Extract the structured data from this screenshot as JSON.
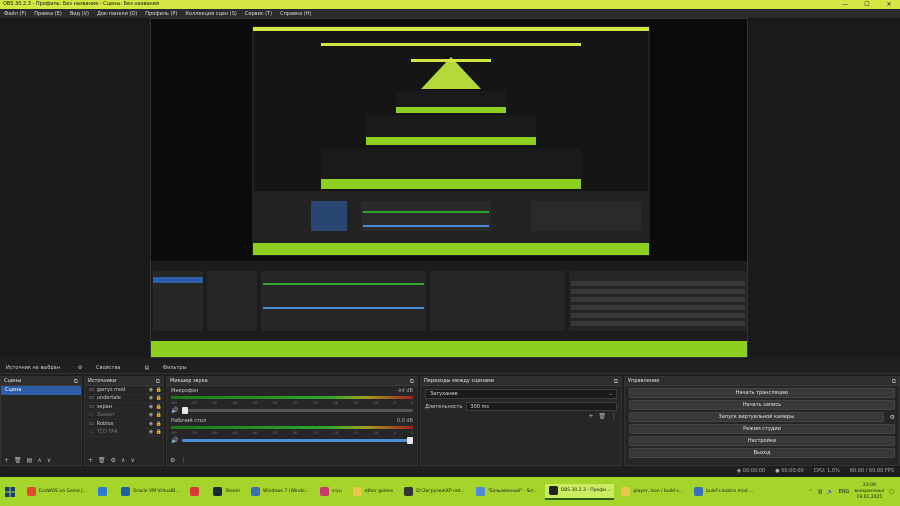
{
  "app": {
    "window_title": "OBS 30.2.3 - Профиль: Без названия - Сцены: Без названия"
  },
  "menu": [
    "Файл (F)",
    "Правка (E)",
    "Вид (V)",
    "Док-панели (D)",
    "Профиль (P)",
    "Коллекция сцен (S)",
    "Сервис (T)",
    "Справка (H)"
  ],
  "source_bar": {
    "no_source": "Источник не выбран",
    "properties": "Свойства",
    "filters": "Фильтры"
  },
  "scenes": {
    "title": "Сцены",
    "items": [
      "Сцена"
    ]
  },
  "sources": {
    "title": "Источники",
    "items": [
      "garrys mod",
      "undertale",
      "экран",
      "Захват",
      "Roblox",
      "TCO FAR"
    ]
  },
  "mixer": {
    "title": "Микшер звука",
    "channels": [
      {
        "name": "Микрофон",
        "db": "-inf dB"
      },
      {
        "name": "Рабочий стол",
        "db": "0.0 dB"
      }
    ],
    "ticks": [
      "-60",
      "-55",
      "-50",
      "-45",
      "-40",
      "-35",
      "-30",
      "-25",
      "-20",
      "-15",
      "-10",
      "-5",
      "0"
    ]
  },
  "transitions": {
    "title": "Переходы между сценами",
    "selected": "Затухание",
    "duration_label": "Длительность",
    "duration_value": "300 ms"
  },
  "controls": {
    "title": "Управление",
    "buttons": [
      "Начать трансляцию",
      "Начать запись",
      "Запуск виртуальной камеры",
      "Режим студии",
      "Настройки",
      "Выход"
    ]
  },
  "status": {
    "stream_time": "00:00:00",
    "rec_time": "00:00:00",
    "cpu": "CPU: 1.0%",
    "fps": "60.00 / 60.00 FPS"
  },
  "taskbar": {
    "items": [
      {
        "label": "EcoWOS на Game J...",
        "color": "#e24a2e"
      },
      {
        "label": "",
        "color": "#2a7bd5"
      },
      {
        "label": "Oracle VM VirtualB...",
        "color": "#1f5fa8"
      },
      {
        "label": "",
        "color": "#d63a3a"
      },
      {
        "label": "Steam",
        "color": "#1b2838"
      },
      {
        "label": "Windows 7 (Windo...",
        "color": "#3a6fb8"
      },
      {
        "label": "cryu",
        "color": "#c83a6b"
      },
      {
        "label": "other games",
        "color": "#e8c74a"
      },
      {
        "label": "D:\\Загрузки\\XP net...",
        "color": "#333333"
      },
      {
        "label": "\"Безымянный\" - Scr...",
        "color": "#4a8ad8"
      },
      {
        "label": "OBS 30.2.3 - Профи...",
        "color": "#222222"
      },
      {
        "label": "player, lson / build s...",
        "color": "#e8c74a"
      },
      {
        "label": "build's basics mod ...",
        "color": "#3a6fb8"
      }
    ],
    "lang": "ENG",
    "time": "23:09",
    "day": "воскресенье",
    "date": "19.01.2025"
  }
}
